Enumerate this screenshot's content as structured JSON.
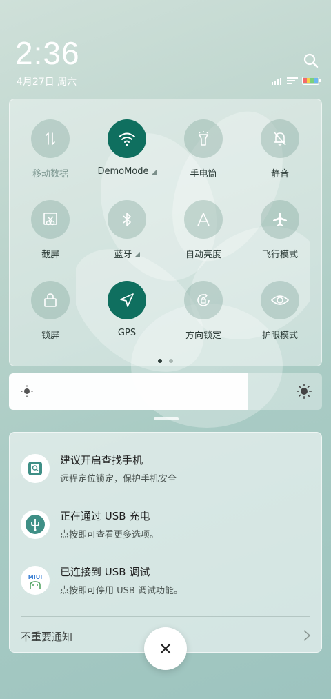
{
  "header": {
    "time": "2:36",
    "date": "4月27日 周六"
  },
  "quick_settings": {
    "tiles": [
      {
        "label": "移动数据",
        "icon": "mobile-data-icon",
        "active": false
      },
      {
        "label": "DemoMode",
        "icon": "wifi-icon",
        "active": true
      },
      {
        "label": "手电筒",
        "icon": "flashlight-icon",
        "active": false
      },
      {
        "label": "静音",
        "icon": "mute-bell-icon",
        "active": false
      },
      {
        "label": "截屏",
        "icon": "screenshot-icon",
        "active": false
      },
      {
        "label": "蓝牙",
        "icon": "bluetooth-icon",
        "active": false
      },
      {
        "label": "自动亮度",
        "icon": "auto-brightness-icon",
        "active": false
      },
      {
        "label": "飞行模式",
        "icon": "airplane-icon",
        "active": false
      },
      {
        "label": "锁屏",
        "icon": "lock-icon",
        "active": false
      },
      {
        "label": "GPS",
        "icon": "gps-icon",
        "active": true
      },
      {
        "label": "方向锁定",
        "icon": "rotation-lock-icon",
        "active": false
      },
      {
        "label": "护眼模式",
        "icon": "eye-icon",
        "active": false
      }
    ],
    "page_count": 2,
    "current_page": 1
  },
  "brightness": {
    "level": 0.765
  },
  "notifications": [
    {
      "title": "建议开启查找手机",
      "subtitle": "远程定位锁定，保护手机安全",
      "icon": "find-device-icon"
    },
    {
      "title": "正在通过 USB 充电",
      "subtitle": "点按即可查看更多选项。",
      "icon": "usb-icon"
    },
    {
      "title": "已连接到 USB 调试",
      "subtitle": "点按即可停用 USB 调试功能。",
      "icon": "miui-icon",
      "icon_text": "MIUI"
    }
  ],
  "unimportant_label": "不重要通知",
  "colors": {
    "accent": "#0f6f5f",
    "background": "#b9d3cb"
  }
}
